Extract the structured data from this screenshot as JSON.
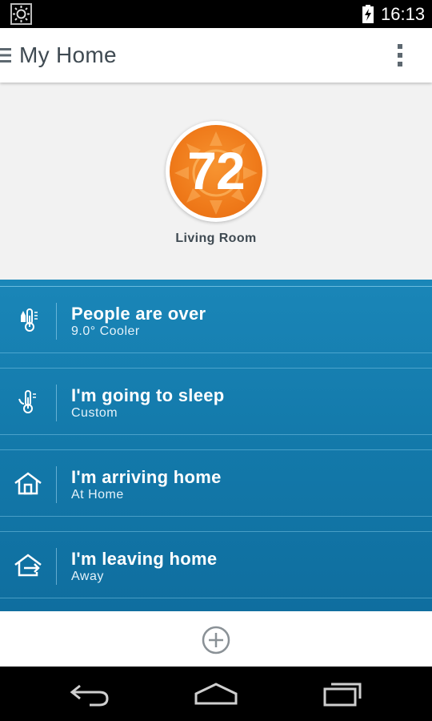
{
  "status_bar": {
    "time": "16:13"
  },
  "header": {
    "title": "My Home"
  },
  "thermostat": {
    "temperature": "72",
    "room": "Living Room"
  },
  "scenes": [
    {
      "name": "People are over",
      "detail": "9.0° Cooler",
      "icon": "thermometer-people-icon"
    },
    {
      "name": "I'm going to sleep",
      "detail": "Custom",
      "icon": "thermometer-sleep-icon"
    },
    {
      "name": "I'm arriving home",
      "detail": "At Home",
      "icon": "house-icon"
    },
    {
      "name": "I'm leaving home",
      "detail": "Away",
      "icon": "house-leave-icon"
    }
  ],
  "colors": {
    "accent_orange": "#ef7a1a",
    "scene_blue": "#1379aa",
    "header_text": "#3f4a52"
  }
}
